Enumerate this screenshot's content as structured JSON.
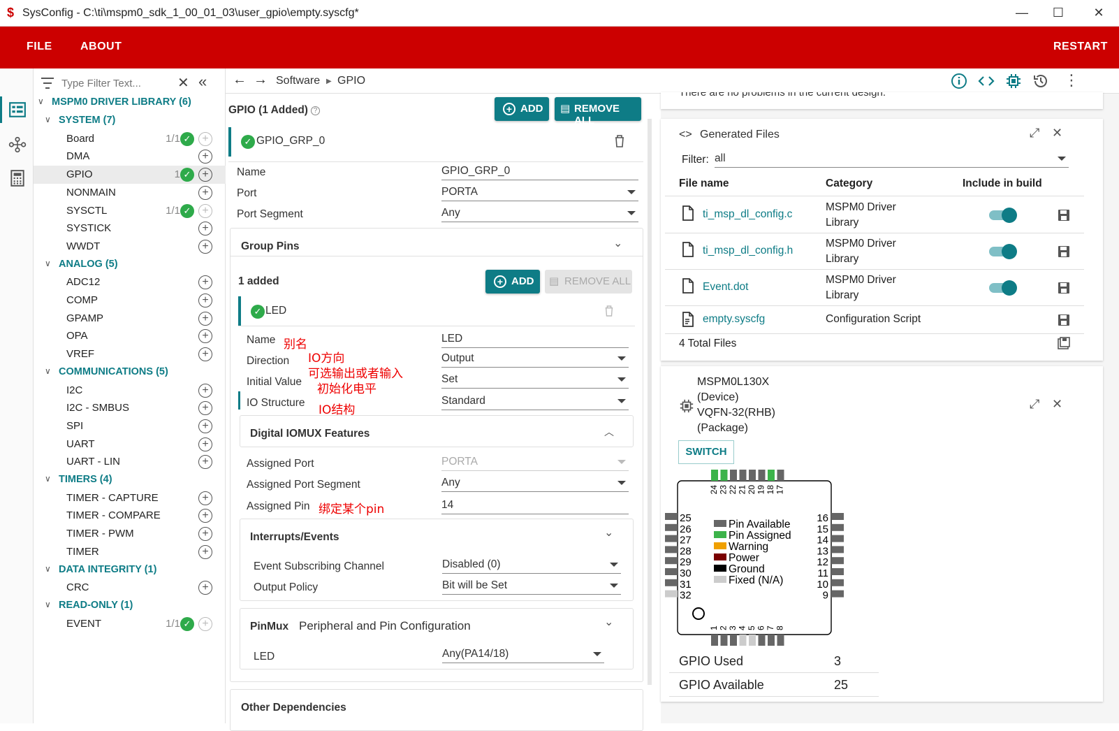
{
  "window": {
    "title": "SysConfig - C:\\ti\\mspm0_sdk_1_00_01_03\\user_gpio\\empty.syscfg*"
  },
  "menu": {
    "file": "FILE",
    "about": "ABOUT",
    "restart": "RESTART"
  },
  "colors": {
    "brand": "#cc0000",
    "accent": "#0e7c86",
    "ok": "#2eaa4a"
  },
  "filter": {
    "placeholder": "Type Filter Text..."
  },
  "tree": {
    "root": "MSPM0 DRIVER LIBRARY (6)",
    "groups": [
      {
        "label": "SYSTEM (7)",
        "items": [
          {
            "label": "Board",
            "count": "1/1",
            "ok": true
          },
          {
            "label": "DMA"
          },
          {
            "label": "GPIO",
            "count": "1",
            "ok": true,
            "selected": true
          },
          {
            "label": "NONMAIN"
          },
          {
            "label": "SYSCTL",
            "count": "1/1",
            "ok": true
          },
          {
            "label": "SYSTICK"
          },
          {
            "label": "WWDT"
          }
        ]
      },
      {
        "label": "ANALOG (5)",
        "items": [
          {
            "label": "ADC12"
          },
          {
            "label": "COMP"
          },
          {
            "label": "GPAMP"
          },
          {
            "label": "OPA"
          },
          {
            "label": "VREF"
          }
        ]
      },
      {
        "label": "COMMUNICATIONS (5)",
        "items": [
          {
            "label": "I2C"
          },
          {
            "label": "I2C - SMBUS"
          },
          {
            "label": "SPI"
          },
          {
            "label": "UART"
          },
          {
            "label": "UART - LIN"
          }
        ]
      },
      {
        "label": "TIMERS (4)",
        "items": [
          {
            "label": "TIMER - CAPTURE"
          },
          {
            "label": "TIMER - COMPARE"
          },
          {
            "label": "TIMER - PWM"
          },
          {
            "label": "TIMER"
          }
        ]
      },
      {
        "label": "DATA INTEGRITY (1)",
        "items": [
          {
            "label": "CRC"
          }
        ]
      },
      {
        "label": "READ-ONLY (1)",
        "items": [
          {
            "label": "EVENT",
            "count": "1/1",
            "ok": true
          }
        ]
      }
    ]
  },
  "breadcrumb": {
    "a": "Software",
    "b": "GPIO"
  },
  "gpio": {
    "header": "GPIO (1 Added)",
    "add": "ADD",
    "remove_all": "REMOVE ALL",
    "instance": "GPIO_GRP_0",
    "name_label": "Name",
    "name_value": "GPIO_GRP_0",
    "port_label": "Port",
    "port_value": "PORTA",
    "segment_label": "Port Segment",
    "segment_value": "Any",
    "group_pins": "Group Pins",
    "added": "1 added",
    "pin": {
      "title": "LED",
      "name_label": "Name",
      "name_value": "LED",
      "direction_label": "Direction",
      "direction_value": "Output",
      "init_label": "Initial Value",
      "init_value": "Set",
      "io_label": "IO Structure",
      "io_value": "Standard"
    },
    "iomux": {
      "title": "Digital IOMUX Features",
      "port_label": "Assigned Port",
      "port_value": "PORTA",
      "seg_label": "Assigned Port Segment",
      "seg_value": "Any",
      "pin_label": "Assigned Pin",
      "pin_value": "14"
    },
    "interrupts": {
      "title": "Interrupts/Events",
      "sub_label": "Event Subscribing Channel",
      "sub_value": "Disabled (0)",
      "out_label": "Output Policy",
      "out_value": "Bit will be Set"
    },
    "pinmux": {
      "title": "PinMux",
      "subtitle": "Peripheral and Pin Configuration",
      "led_label": "LED",
      "led_value": "Any(PA14/18)"
    },
    "other": "Other Dependencies"
  },
  "annotations": {
    "alias": "别名",
    "dir1": "IO方向",
    "dir2": "可选输出或者输入",
    "init": "初始化电平",
    "io": "IO结构",
    "pin": "绑定某个pin"
  },
  "problems": {
    "text": "There are no problems in the current design."
  },
  "generated": {
    "title": "Generated Files",
    "filter_label": "Filter:",
    "filter_value": "all",
    "col_file": "File name",
    "col_cat": "Category",
    "col_build": "Include in build",
    "rows": [
      {
        "file": "ti_msp_dl_config.c",
        "cat1": "MSPM0 Driver",
        "cat2": "Library"
      },
      {
        "file": "ti_msp_dl_config.h",
        "cat1": "MSPM0 Driver",
        "cat2": "Library"
      },
      {
        "file": "Event.dot",
        "cat1": "MSPM0 Driver",
        "cat2": "Library"
      },
      {
        "file": "empty.syscfg",
        "cat1": "Configuration Script",
        "cat2": ""
      }
    ],
    "total": "4 Total Files"
  },
  "device": {
    "name": "MSPM0L130X",
    "name_note": "(Device)",
    "pkg": "VQFN-32(RHB)",
    "pkg_note": "(Package)",
    "switch": "SWITCH",
    "pins_top": [
      "24",
      "23",
      "22",
      "21",
      "20",
      "19",
      "18",
      "17"
    ],
    "pins_left": [
      "25",
      "26",
      "27",
      "28",
      "29",
      "30",
      "31",
      "32"
    ],
    "pins_right": [
      "16",
      "15",
      "14",
      "13",
      "12",
      "11",
      "10",
      "9"
    ],
    "pins_bottom": [
      "1",
      "2",
      "3",
      "4",
      "5",
      "6",
      "7",
      "8"
    ],
    "legend": [
      "Pin Available",
      "Pin Assigned",
      "Warning",
      "Power",
      "Ground",
      "Fixed (N/A)"
    ],
    "legend_colors": [
      "#666666",
      "#3cb34a",
      "#f0a000",
      "#7a0000",
      "#000000",
      "#cccccc"
    ],
    "used_label": "GPIO Used",
    "used": "3",
    "avail_label": "GPIO Available",
    "avail": "25"
  }
}
